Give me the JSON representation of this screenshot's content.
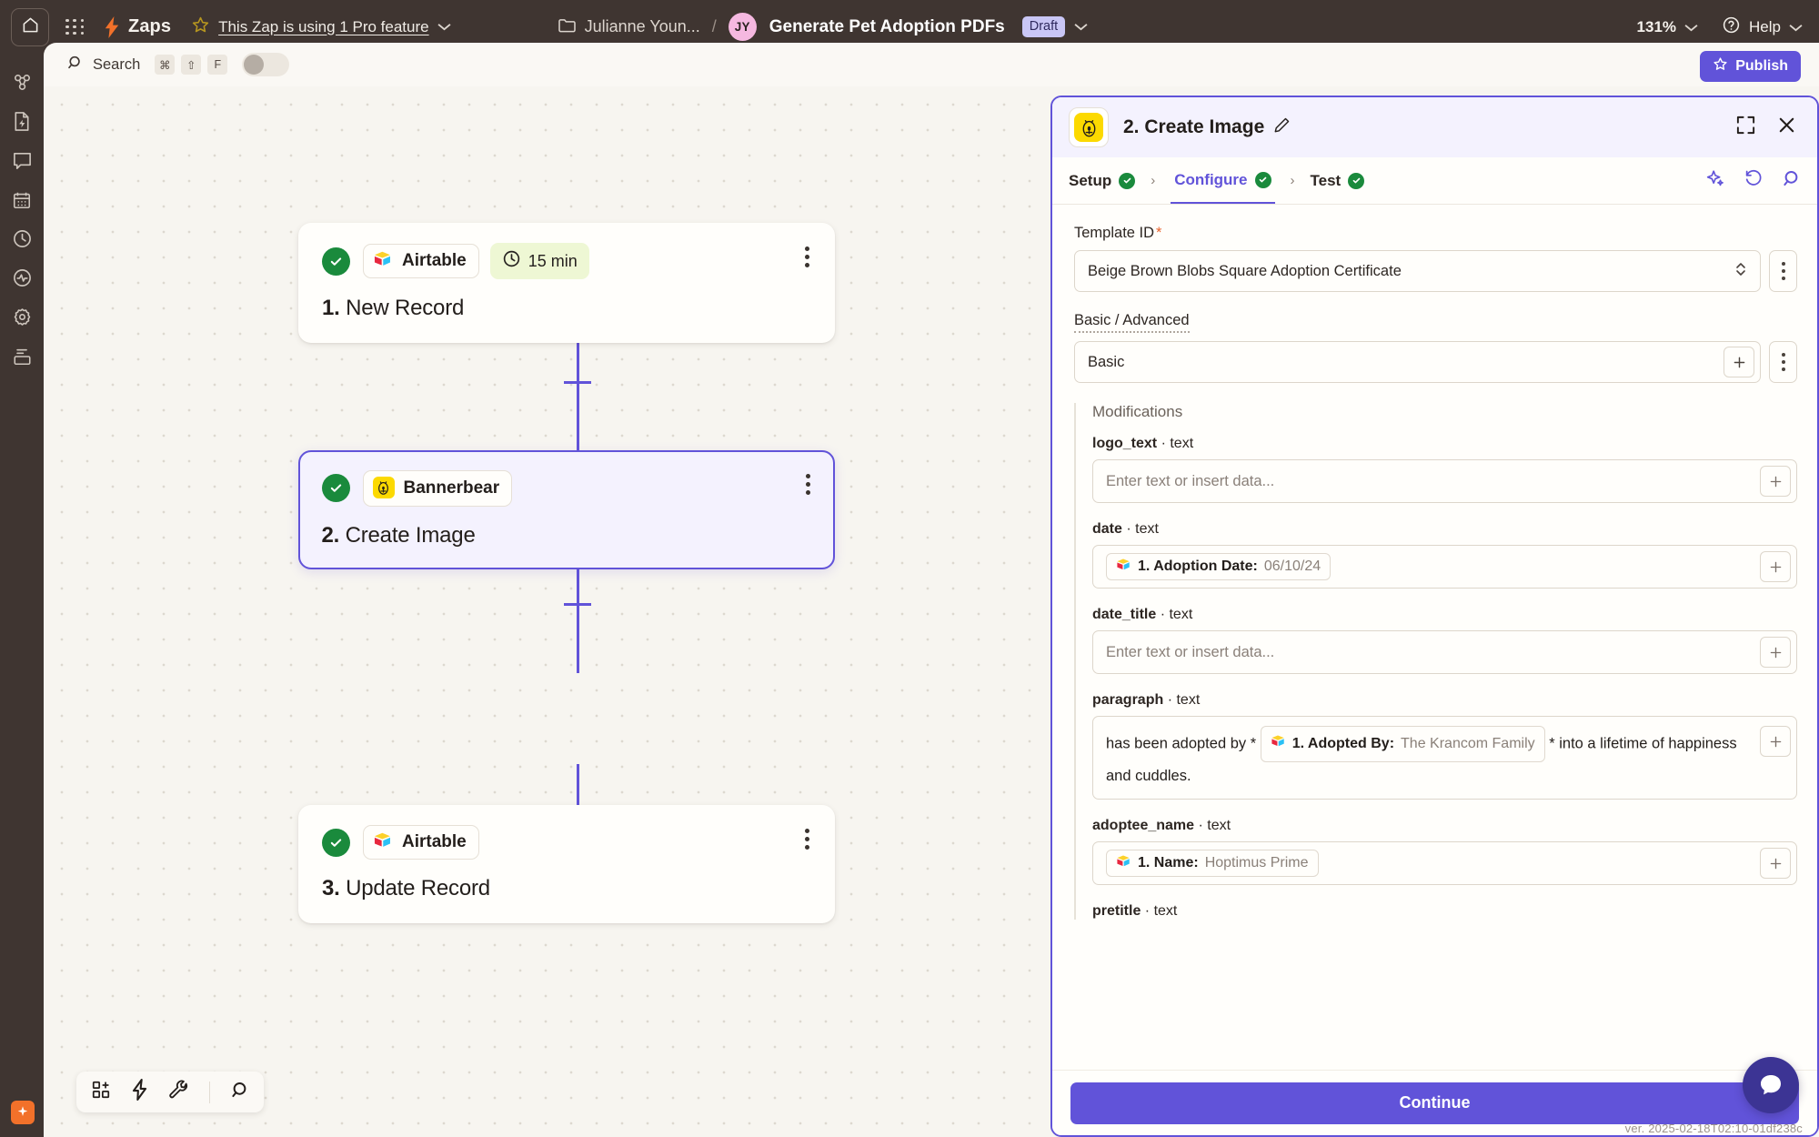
{
  "topbar": {
    "home_icon": "home-icon",
    "apps_icon": "app-grid-icon",
    "bolt_icon": "zap-bolt-icon",
    "zaps_label": "Zaps",
    "star_icon": "star-icon",
    "pro_feature_text": "This Zap is using 1 Pro feature",
    "folder_icon": "folder-icon",
    "folder_name": "Julianne Youn...",
    "separator": "/",
    "avatar_initials": "JY",
    "zap_title": "Generate Pet Adoption PDFs",
    "status_badge": "Draft",
    "zoom_level": "131%",
    "help_label": "Help",
    "help_icon": "question-circle-icon",
    "chevron_icon": "chevron-down-icon"
  },
  "rail": {
    "items": [
      {
        "icon": "nodes-icon",
        "name": "zaps"
      },
      {
        "icon": "document-bolt-icon",
        "name": "templates"
      },
      {
        "icon": "chat-icon",
        "name": "chatbots"
      },
      {
        "icon": "table-grid-icon",
        "name": "tables"
      },
      {
        "icon": "clock-icon",
        "name": "history"
      },
      {
        "icon": "pulse-icon",
        "name": "activity"
      },
      {
        "icon": "gear-icon",
        "name": "settings"
      },
      {
        "icon": "interfaces-icon",
        "name": "interfaces"
      }
    ],
    "bottom_icon": "sparkle-icon"
  },
  "search": {
    "icon": "search-icon",
    "label": "Search",
    "shortcut_keys": [
      "⌘",
      "⇧",
      "F"
    ],
    "toggle_state": "off"
  },
  "publish": {
    "label": "Publish",
    "icon": "star-icon",
    "color": "#6153d9"
  },
  "canvas": {
    "nodes": [
      {
        "status_icon": "check-circle-icon",
        "app": "Airtable",
        "app_icon": "airtable-icon",
        "badge": "15 min",
        "badge_icon": "clock-icon",
        "step_number": "1.",
        "title": "New Record",
        "selected": false
      },
      {
        "status_icon": "check-circle-icon",
        "app": "Bannerbear",
        "app_icon": "bannerbear-icon",
        "badge": null,
        "step_number": "2.",
        "title": "Create Image",
        "selected": true
      },
      {
        "status_icon": "check-circle-icon",
        "app": "Airtable",
        "app_icon": "airtable-icon",
        "badge": null,
        "step_number": "3.",
        "title": "Update Record",
        "selected": false
      }
    ],
    "add_step_icon": "plus-icon",
    "bottom_tools": [
      {
        "icon": "add-grid-icon",
        "name": "add-step"
      },
      {
        "icon": "zap-bolt-icon",
        "name": "zap-actions"
      },
      {
        "icon": "wrench-icon",
        "name": "tools"
      },
      {
        "icon": "search-icon",
        "name": "search-canvas"
      }
    ]
  },
  "panel": {
    "app_icon": "bannerbear-icon",
    "title": "2. Create Image",
    "edit_icon": "pencil-icon",
    "expand_icon": "expand-icon",
    "close_icon": "close-icon",
    "tabs": [
      {
        "label": "Setup",
        "state": "complete",
        "active": false
      },
      {
        "label": "Configure",
        "state": "complete",
        "active": true
      },
      {
        "label": "Test",
        "state": "complete",
        "active": false
      }
    ],
    "tab_separator": "›",
    "tab_icons": [
      {
        "icon": "ai-sparkle-icon",
        "name": "ai-assist"
      },
      {
        "icon": "undo-icon",
        "name": "revert-changes"
      },
      {
        "icon": "search-icon",
        "name": "search-fields"
      }
    ],
    "fields": {
      "template_id": {
        "label": "Template ID",
        "required_marker": "*",
        "value": "Beige Brown Blobs Square Adoption Certificate",
        "dropdown_icon": "chevron-updown-icon",
        "menu_icon": "kebab-icon"
      },
      "basic_advanced": {
        "label": "Basic / Advanced",
        "value": "Basic",
        "add_icon": "plus-icon",
        "menu_icon": "kebab-icon"
      }
    },
    "modifications": {
      "heading": "Modifications",
      "items": [
        {
          "label_key": "logo_text",
          "label_type": " · text",
          "placeholder": "Enter text or insert data...",
          "token": null,
          "add_icon": "plus-icon"
        },
        {
          "label_key": "date",
          "label_type": " · text",
          "placeholder": null,
          "token": {
            "source_icon": "airtable-icon",
            "field": "1. Adoption Date:",
            "value": "06/10/24"
          },
          "add_icon": "plus-icon"
        },
        {
          "label_key": "date_title",
          "label_type": " · text",
          "placeholder": "Enter text or insert data...",
          "token": null,
          "add_icon": "plus-icon"
        },
        {
          "label_key": "paragraph",
          "label_type": " · text",
          "text_before": "has been adopted by *",
          "token": {
            "source_icon": "airtable-icon",
            "field": "1. Adopted By:",
            "value": "The Krancom Family"
          },
          "text_after": "* into a lifetime of happiness and cuddles.",
          "add_icon": "plus-icon"
        },
        {
          "label_key": "adoptee_name",
          "label_type": " · text",
          "placeholder": null,
          "token": {
            "source_icon": "airtable-icon",
            "field": "1. Name:",
            "value": "Hoptimus Prime"
          },
          "add_icon": "plus-icon"
        },
        {
          "label_key": "pretitle",
          "label_type": " · text",
          "placeholder": null,
          "token": null,
          "add_icon": "plus-icon"
        }
      ]
    },
    "continue_label": "Continue"
  },
  "chat_widget": {
    "icon": "chat-bubble-icon",
    "color": "#3c3494"
  },
  "version_text": "ver. 2025-02-18T02:10-01df238c"
}
